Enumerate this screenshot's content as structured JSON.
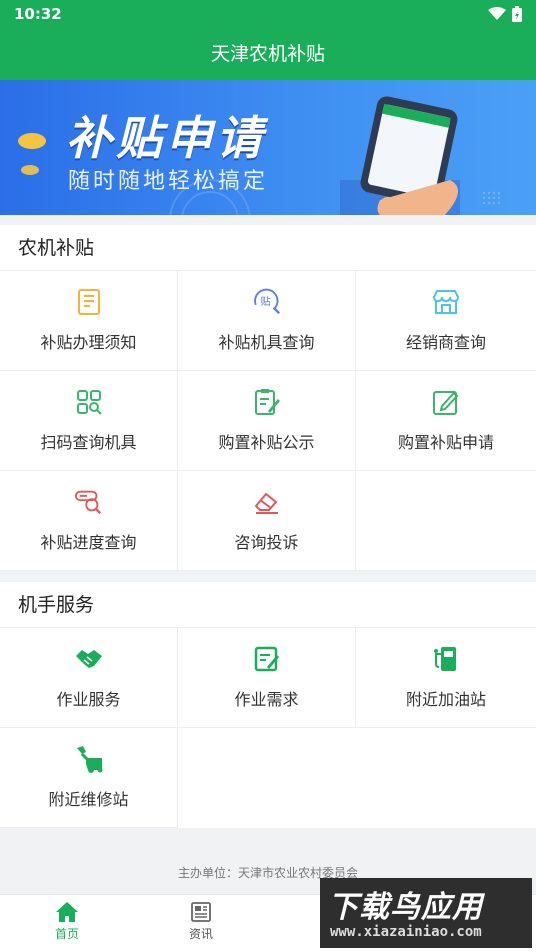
{
  "status": {
    "time": "10:32"
  },
  "app": {
    "title": "天津农机补贴"
  },
  "banner": {
    "title": "补贴申请",
    "subtitle": "随时随地轻松搞定"
  },
  "subsidy": {
    "title": "农机补贴",
    "items": [
      {
        "label": "补贴办理须知",
        "icon": "document-icon",
        "color": "#f2b53a"
      },
      {
        "label": "补贴机具查询",
        "icon": "subsidy-search-icon",
        "color": "#5b7ee5"
      },
      {
        "label": "经销商查询",
        "icon": "store-icon",
        "color": "#4fc3e6"
      },
      {
        "label": "扫码查询机具",
        "icon": "scan-grid-icon",
        "color": "#3bb56e"
      },
      {
        "label": "购置补贴公示",
        "icon": "clipboard-pen-icon",
        "color": "#3bb56e"
      },
      {
        "label": "购置补贴申请",
        "icon": "edit-icon",
        "color": "#3bb56e"
      },
      {
        "label": "补贴进度查询",
        "icon": "progress-search-icon",
        "color": "#e0585b"
      },
      {
        "label": "咨询投诉",
        "icon": "eraser-icon",
        "color": "#e0585b"
      }
    ]
  },
  "operator": {
    "title": "机手服务",
    "items": [
      {
        "label": "作业服务",
        "icon": "handshake-icon",
        "color": "#1aae5a"
      },
      {
        "label": "作业需求",
        "icon": "request-form-icon",
        "color": "#1aae5a"
      },
      {
        "label": "附近加油站",
        "icon": "gas-station-icon",
        "color": "#1aae5a"
      },
      {
        "label": "附近维修站",
        "icon": "repair-icon",
        "color": "#1aae5a"
      }
    ]
  },
  "footer": {
    "note": "主办单位：天津市农业农村委员会"
  },
  "tabs": [
    {
      "label": "首页",
      "icon": "home-icon",
      "active": true
    },
    {
      "label": "资讯",
      "icon": "news-icon",
      "active": false
    }
  ],
  "watermark": {
    "big": "下载鸟应用",
    "small": "www.xiazainiao.com"
  },
  "colors": {
    "brand": "#1aae5a",
    "banner": "#2b6ee8"
  }
}
